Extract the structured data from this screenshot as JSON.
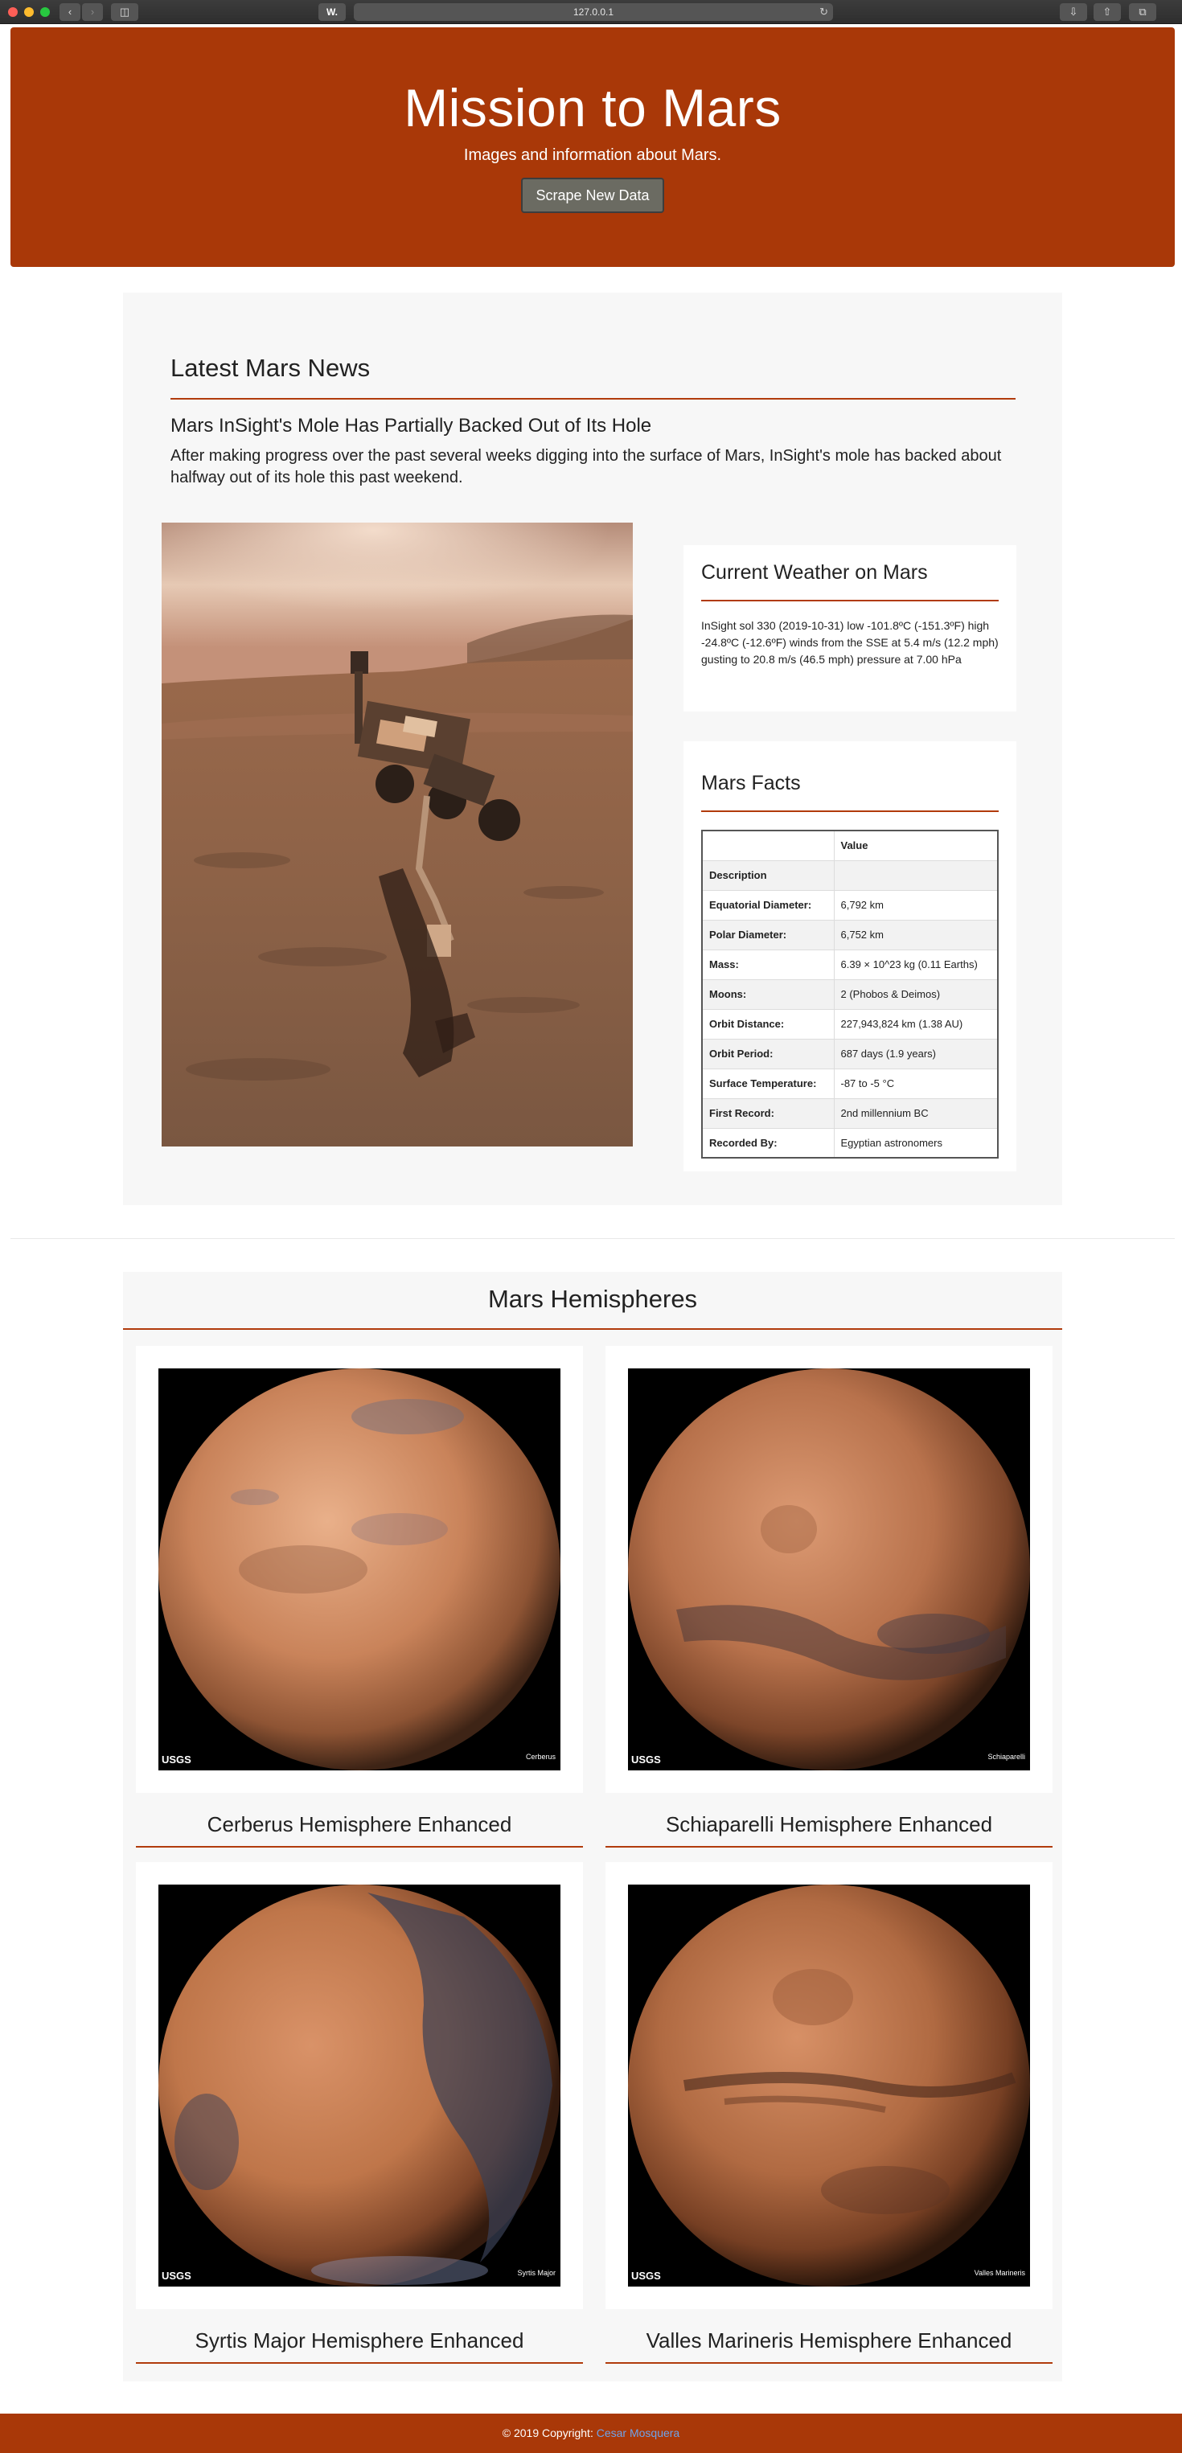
{
  "browser": {
    "url": "127.0.0.1",
    "favicon_label": "W."
  },
  "jumbotron": {
    "title": "Mission to Mars",
    "subtitle": "Images and information about Mars.",
    "button_label": "Scrape New Data"
  },
  "news": {
    "section_title": "Latest Mars News",
    "headline": "Mars InSight's Mole Has Partially Backed Out of Its Hole",
    "teaser": "After making progress over the past several weeks digging into the surface of Mars, InSight's mole has backed about halfway out of its hole this past weekend."
  },
  "weather": {
    "title": "Current Weather on Mars",
    "text": "InSight sol 330 (2019-10-31) low -101.8ºC (-151.3ºF) high -24.8ºC (-12.6ºF) winds from the SSE at 5.4 m/s (12.2 mph) gusting to 20.8 m/s (46.5 mph) pressure at 7.00 hPa"
  },
  "facts": {
    "title": "Mars Facts",
    "header_value": "Value",
    "rows": [
      {
        "key": "Description",
        "value": ""
      },
      {
        "key": "Equatorial Diameter:",
        "value": "6,792 km"
      },
      {
        "key": "Polar Diameter:",
        "value": "6,752 km"
      },
      {
        "key": "Mass:",
        "value": "6.39 × 10^23 kg (0.11 Earths)"
      },
      {
        "key": "Moons:",
        "value": "2 (Phobos & Deimos)"
      },
      {
        "key": "Orbit Distance:",
        "value": "227,943,824 km (1.38 AU)"
      },
      {
        "key": "Orbit Period:",
        "value": "687 days (1.9 years)"
      },
      {
        "key": "Surface Temperature:",
        "value": "-87 to -5 °C"
      },
      {
        "key": "First Record:",
        "value": "2nd millennium BC"
      },
      {
        "key": "Recorded By:",
        "value": "Egyptian astronomers"
      }
    ]
  },
  "hemispheres": {
    "title": "Mars Hemispheres",
    "items": [
      {
        "name": "Cerberus Hemisphere Enhanced",
        "caption": "Cerberus",
        "logo": "USGS"
      },
      {
        "name": "Schiaparelli Hemisphere Enhanced",
        "caption": "Schiaparelli",
        "logo": "USGS"
      },
      {
        "name": "Syrtis Major Hemisphere Enhanced",
        "caption": "Syrtis Major",
        "logo": "USGS"
      },
      {
        "name": "Valles Marineris Hemisphere Enhanced",
        "caption": "Valles Marineris",
        "logo": "USGS"
      }
    ]
  },
  "footer": {
    "text": "© 2019 Copyright: ",
    "author": "Cesar Mosquera"
  },
  "colors": {
    "brand": "#a93808",
    "accent_rule": "#b13b0c"
  }
}
